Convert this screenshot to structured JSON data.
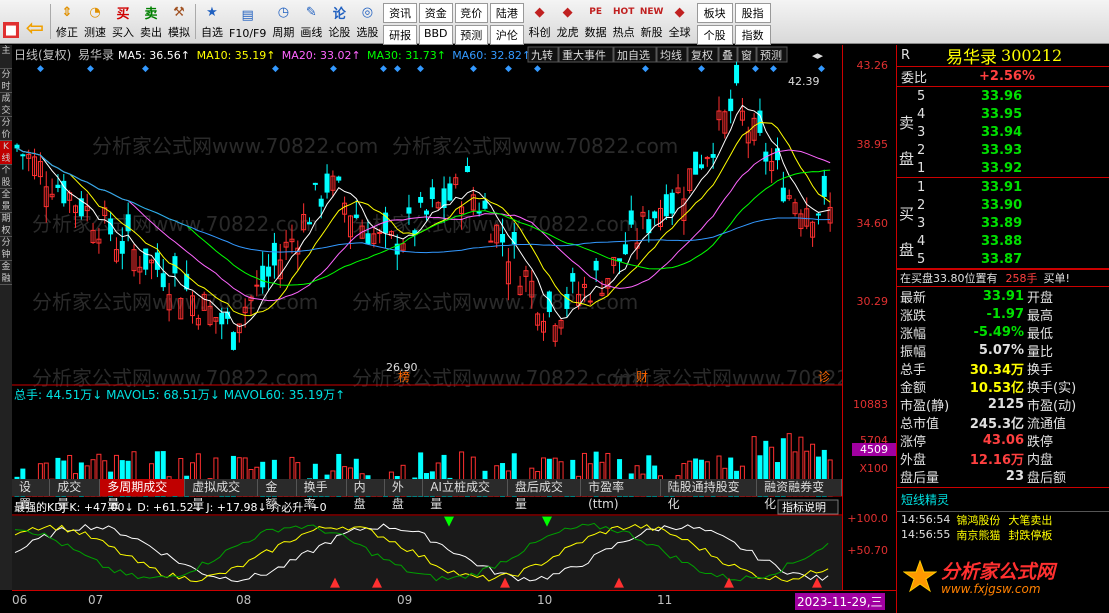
{
  "toolbar": {
    "items": [
      {
        "label": "",
        "icon": "home-icon"
      },
      {
        "label": "",
        "icon": "back-arrow-icon"
      },
      {
        "label": "修正",
        "icon": "up-down-arrow-icon"
      },
      {
        "label": "测速",
        "icon": "alarm-clock-icon"
      },
      {
        "label": "买入",
        "icon": "buy-icon",
        "glyph": "买"
      },
      {
        "label": "卖出",
        "icon": "sell-icon",
        "glyph": "卖"
      },
      {
        "label": "模拟",
        "icon": "gavel-icon"
      },
      {
        "label": "自选",
        "icon": "star-icon"
      },
      {
        "label": "F10/F9",
        "icon": "document-icon"
      },
      {
        "label": "周期",
        "icon": "period-icon"
      },
      {
        "label": "画线",
        "icon": "pencil-icon"
      },
      {
        "label": "论股",
        "icon": "chat-icon"
      },
      {
        "label": "选股",
        "icon": "radar-icon"
      }
    ],
    "grid": [
      "资讯",
      "资金",
      "竞价",
      "陆港",
      "研报",
      "BBD",
      "预测",
      "沪伦"
    ],
    "right": [
      {
        "label": "科创",
        "icon": "pencil-red-icon"
      },
      {
        "label": "龙虎",
        "icon": "tiger-icon"
      },
      {
        "label": "数据",
        "icon": "pe-icon",
        "glyph": "PE"
      },
      {
        "label": "热点",
        "icon": "hot-icon",
        "glyph": "HOT"
      },
      {
        "label": "新股",
        "icon": "new-icon",
        "glyph": "NEW"
      },
      {
        "label": "全球",
        "icon": "globe-icon"
      }
    ],
    "mini": [
      "板块",
      "股指",
      "个股",
      "指数"
    ]
  },
  "sidebar": [
    "主",
    "分时",
    "成交",
    "分价",
    "K线",
    "个股",
    "全景",
    "期权",
    "分钟",
    "金融"
  ],
  "chart": {
    "title": "日线(复权)",
    "stock": "易华录",
    "ma": [
      {
        "label": "MA5: 36.56↑",
        "color": "#ffffff"
      },
      {
        "label": "MA10: 35.19↑",
        "color": "#ffff00"
      },
      {
        "label": "MA20: 33.02↑",
        "color": "#ff66ff"
      },
      {
        "label": "MA30: 31.73↑",
        "color": "#00ff00"
      },
      {
        "label": "MA60: 32.82↑",
        "color": "#3399ff"
      }
    ],
    "buttons": [
      "九转",
      "重大事件",
      "加自选",
      "均线",
      "复权",
      "叠",
      "窗",
      "预测"
    ],
    "high_label": "42.39",
    "low_label": "26.90",
    "markers": [
      "榜",
      "财",
      "诊"
    ],
    "price_ticks": [
      "43.26",
      "38.95",
      "34.60",
      "30.29"
    ],
    "vol_header": "总手: 44.51万↓  MAVOL5: 68.51万↓  MAVOL60: 35.19万↑",
    "vol_ticks": [
      "10883",
      "5704",
      "4509",
      "X100"
    ],
    "kdj_header": "最强的KDJ K: +47.00↓ D: +61.52↓ J: +17.98↓ 介必升: +0",
    "kdj_ticks": [
      "+100.0",
      "+50.70"
    ],
    "kdj_button": "指标说明",
    "watermark": "分析家公式网www.70822.com"
  },
  "tabs": [
    "设置",
    "成交量",
    "多周期成交量",
    "虚拟成交量",
    "金额",
    "换手率",
    "内盘",
    "外盘",
    "AI立桩成交量",
    "盘后成交量",
    "市盈率(ttm)",
    "陆股通持股变化",
    "融资融券变化"
  ],
  "active_tab": "多周期成交量",
  "x_axis": [
    "06",
    "07",
    "08",
    "09",
    "10",
    "11",
    "2023-11-29,三"
  ],
  "panel": {
    "r": "R",
    "name": "易华录",
    "code": "300212",
    "weibi_label": "委比",
    "weibi": "+2.56%",
    "sell": [
      {
        "n": "5",
        "p": "33.96"
      },
      {
        "n": "4",
        "p": "33.95"
      },
      {
        "n": "3",
        "p": "33.94"
      },
      {
        "n": "2",
        "p": "33.93"
      },
      {
        "n": "1",
        "p": "33.92"
      }
    ],
    "buy": [
      {
        "n": "1",
        "p": "33.91"
      },
      {
        "n": "2",
        "p": "33.90"
      },
      {
        "n": "3",
        "p": "33.89"
      },
      {
        "n": "4",
        "p": "33.88"
      },
      {
        "n": "5",
        "p": "33.87"
      }
    ],
    "sell_label": [
      "卖",
      "盘"
    ],
    "buy_label": [
      "买",
      "盘"
    ],
    "note": "在买盘33.80位置有",
    "note_qty": "258手",
    "note_act": "买单!",
    "stats": [
      {
        "l": "最新",
        "v": "33.91",
        "r": "开盘",
        "c": "green"
      },
      {
        "l": "涨跌",
        "v": "-1.97",
        "r": "最高",
        "c": "green"
      },
      {
        "l": "涨幅",
        "v": "-5.49%",
        "r": "最低",
        "c": "green"
      },
      {
        "l": "振幅",
        "v": "5.07%",
        "r": "量比",
        "c": "white"
      },
      {
        "l": "总手",
        "v": "30.34万",
        "r": "换手",
        "c": "yellow"
      },
      {
        "l": "金额",
        "v": "10.53亿",
        "r": "换手(实)",
        "c": "yellow"
      },
      {
        "l": "市盈(静)",
        "v": "2125",
        "r": "市盈(动)",
        "c": "white"
      },
      {
        "l": "总市值",
        "v": "245.3亿",
        "r": "流通值",
        "c": "white"
      },
      {
        "l": "涨停",
        "v": "43.06",
        "r": "跌停",
        "c": "red"
      },
      {
        "l": "外盘",
        "v": "12.16万",
        "r": "内盘",
        "c": "red"
      },
      {
        "l": "盘后量",
        "v": "23",
        "r": "盘后额",
        "c": "white"
      }
    ],
    "short_title": "短线精灵",
    "short": [
      {
        "t": "14:56:54",
        "a": "锦鸿股份",
        "b": "大笔卖出"
      },
      {
        "t": "14:56:55",
        "a": "南京熊猫",
        "b": "封跌停板"
      }
    ],
    "logo": "分析家公式网",
    "url": "www.fxjgsw.com"
  },
  "colors": {
    "up": "#ff3030",
    "down": "#00ffff",
    "axis": "#cc0000"
  }
}
